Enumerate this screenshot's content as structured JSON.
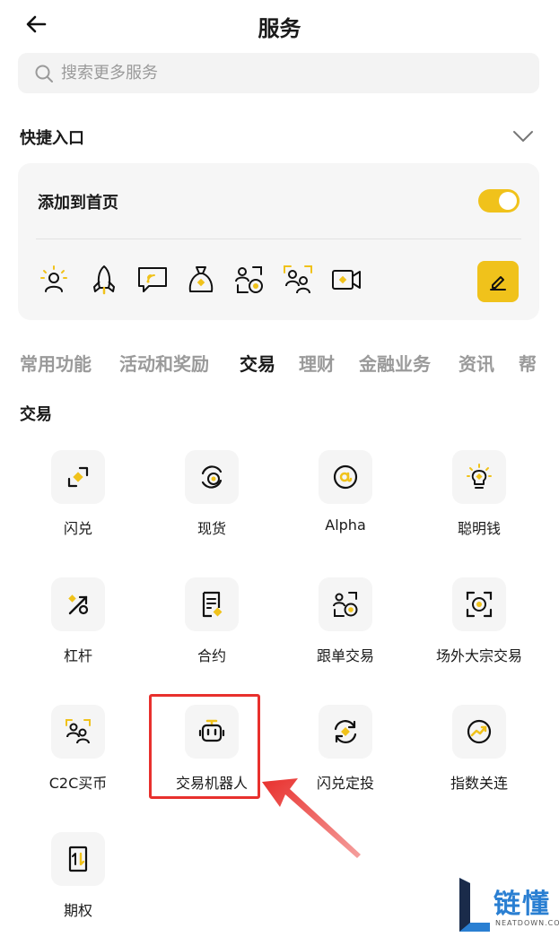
{
  "header": {
    "title": "服务"
  },
  "search": {
    "placeholder": "搜索更多服务"
  },
  "quick_entry": {
    "title": "快捷入口",
    "add_to_home_label": "添加到首页",
    "toggle_on": true,
    "icons": [
      "lightbulb-person-icon",
      "rocket-icon",
      "chat-signal-icon",
      "money-bag-icon",
      "copy-trade-icon",
      "c2c-users-icon",
      "video-camera-icon"
    ]
  },
  "tabs": [
    {
      "label": "常用功能",
      "active": false
    },
    {
      "label": "活动和奖励",
      "active": false
    },
    {
      "label": "交易",
      "active": true
    },
    {
      "label": "理财",
      "active": false
    },
    {
      "label": "金融业务",
      "active": false
    },
    {
      "label": "资讯",
      "active": false
    },
    {
      "label": "帮",
      "active": false
    }
  ],
  "trade_group": {
    "title": "交易",
    "items": [
      {
        "label": "闪兑",
        "icon": "flash-swap-icon"
      },
      {
        "label": "现货",
        "icon": "spot-icon"
      },
      {
        "label": "Alpha",
        "icon": "alpha-icon"
      },
      {
        "label": "聪明钱",
        "icon": "smart-money-bulb-icon"
      },
      {
        "label": "杠杆",
        "icon": "leverage-percent-icon"
      },
      {
        "label": "合约",
        "icon": "contract-document-icon"
      },
      {
        "label": "跟单交易",
        "icon": "copy-trading-icon"
      },
      {
        "label": "场外大宗交易",
        "icon": "otc-block-trade-icon"
      },
      {
        "label": "C2C买币",
        "icon": "c2c-buy-icon"
      },
      {
        "label": "交易机器人",
        "icon": "trading-bot-icon"
      },
      {
        "label": "闪兑定投",
        "icon": "recurring-swap-icon"
      },
      {
        "label": "指数关连",
        "icon": "index-link-icon"
      },
      {
        "label": "期权",
        "icon": "options-icon"
      }
    ]
  },
  "watermark": {
    "text": "链懂",
    "sub": "NEATDOWN.COM"
  },
  "colors": {
    "accent": "#f0c21b",
    "highlight": "#e8302d",
    "watermark": "#2a7fd2"
  }
}
